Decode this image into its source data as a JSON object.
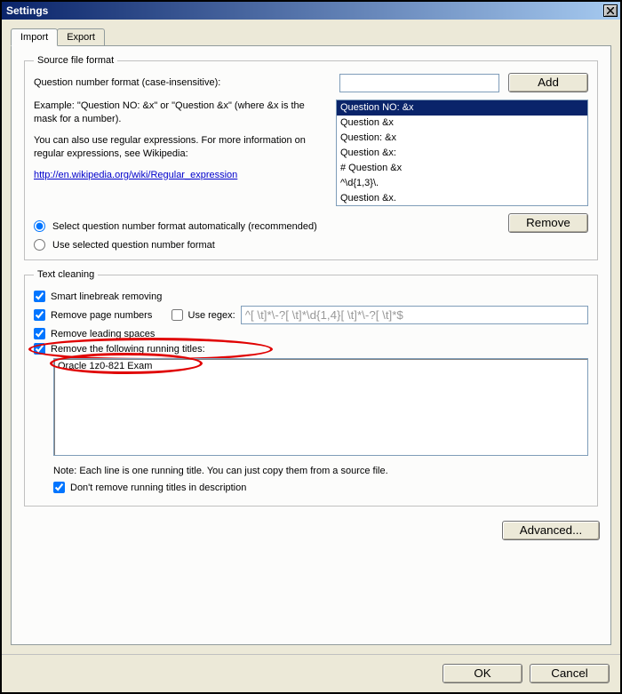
{
  "window": {
    "title": "Settings"
  },
  "tabs": {
    "import": "Import",
    "export": "Export"
  },
  "source": {
    "legend": "Source file format",
    "qformat_label": "Question number format (case-insensitive):",
    "add_label": "Add",
    "example_text": "Example: \"Question NO: &x\" or \"Question &x\" (where &x is the mask for a number).",
    "regex_text": "You can also use regular expressions. For more information on regular expressions, see Wikipedia:",
    "regex_link": "http://en.wikipedia.org/wiki/Regular_expression",
    "list_items": [
      "Question NO: &x",
      "Question &x",
      "Question: &x",
      "Question &x:",
      "# Question &x",
      "^\\d{1,3}\\.",
      "Question &x."
    ],
    "radio_auto": "Select question number format automatically (recommended)",
    "radio_manual": "Use selected question number format",
    "remove_label": "Remove"
  },
  "cleaning": {
    "legend": "Text cleaning",
    "smart_linebreak": "Smart linebreak removing",
    "remove_pagenum": "Remove page numbers",
    "use_regex": "Use regex:",
    "regex_placeholder": "^[ \\t]*\\-?[ \\t]*\\d{1,4}[ \\t]*\\-?[ \\t]*$",
    "remove_leading": "Remove leading spaces",
    "remove_running": "Remove the following running titles:",
    "running_textarea_value": "Oracle 1z0-821 Exam",
    "note_text": "Note: Each line is one running title. You can just copy them from a source file.",
    "dont_remove_desc": "Don't remove running titles in description"
  },
  "advanced_label": "Advanced...",
  "ok_label": "OK",
  "cancel_label": "Cancel"
}
